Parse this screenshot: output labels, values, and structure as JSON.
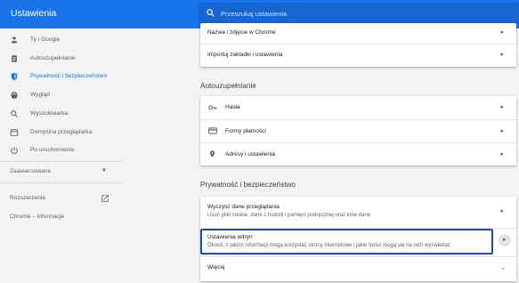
{
  "header": {
    "title": "Ustawienia",
    "search_placeholder": "Przeszukaj ustawienia"
  },
  "sidebar": {
    "items": [
      {
        "label": "Ty i Google",
        "icon": "person-icon"
      },
      {
        "label": "Autouzupełnianie",
        "icon": "clipboard-icon"
      },
      {
        "label": "Prywatność i bezpieczeństwo",
        "icon": "shield-icon",
        "active": true
      },
      {
        "label": "Wygląd",
        "icon": "palette-icon"
      },
      {
        "label": "Wyszukiwarka",
        "icon": "search-icon"
      },
      {
        "label": "Domyślna przeglądarka",
        "icon": "browser-icon"
      },
      {
        "label": "Po uruchomieniu",
        "icon": "power-icon"
      }
    ],
    "advanced": "Zaawansowane",
    "extensions": "Rozszerzenia",
    "about": "Chrome – informacje"
  },
  "main": {
    "top_card": {
      "rows": [
        "Nazwa i zdjęcie w Chrome",
        "Importuj zakładki i ustawienia"
      ]
    },
    "autofill": {
      "title": "Autouzupełnianie",
      "rows": [
        "Hasła",
        "Formy płatności",
        "Adresy i ustawienia"
      ]
    },
    "privacy": {
      "title": "Prywatność i bezpieczeństwo",
      "clear": {
        "title": "Wyczyść dane przeglądania",
        "desc": "Usuń pliki cookie, dane z historii i pamięci podręcznej oraz inne dane"
      },
      "site_settings": {
        "title": "Ustawienia witryn",
        "desc": "Określ, z jakich informacji mogą korzystać strony internetowe i jakie treści mogą się na nich wyświetlać"
      },
      "more": "Więcej"
    }
  },
  "colors": {
    "accent": "#1a73e8",
    "highlight_border": "#1c4fa1"
  }
}
